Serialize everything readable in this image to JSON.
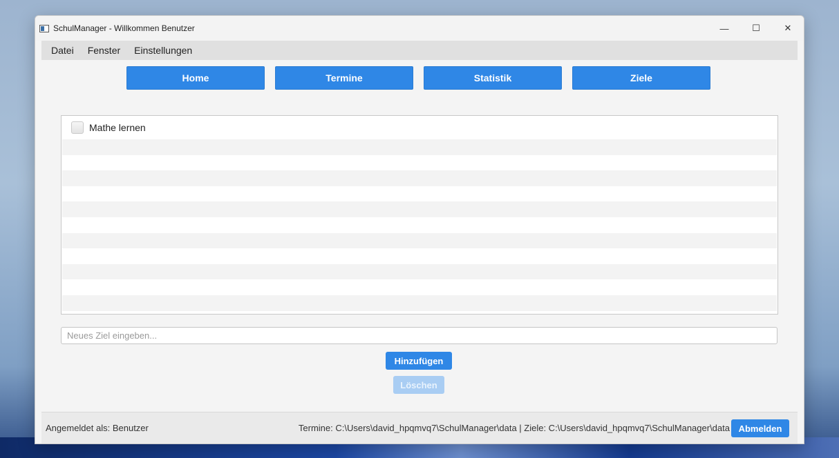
{
  "window": {
    "title": "SchulManager - Willkommen Benutzer",
    "controls": {
      "minimize": "—",
      "maximize": "☐",
      "close": "✕"
    }
  },
  "menu": {
    "items": [
      "Datei",
      "Fenster",
      "Einstellungen"
    ]
  },
  "nav": {
    "buttons": [
      "Home",
      "Termine",
      "Statistik",
      "Ziele"
    ]
  },
  "goals": {
    "items": [
      {
        "label": "Mathe lernen",
        "checked": false
      }
    ]
  },
  "form": {
    "placeholder": "Neues Ziel eingeben...",
    "value": "",
    "add_label": "Hinzufügen",
    "delete_label": "Löschen"
  },
  "status": {
    "user_text": "Angemeldet als: Benutzer",
    "paths_text": "Termine: C:\\Users\\david_hpqmvq7\\SchulManager\\data | Ziele: C:\\Users\\david_hpqmvq7\\SchulManager\\data",
    "logout_label": "Abmelden"
  },
  "colors": {
    "accent": "#2f87e6",
    "accent_disabled": "#a9cdf3",
    "menubar": "#e0e0e0",
    "window_bg": "#f4f4f4"
  },
  "icons": {
    "app": "app-window-icon",
    "minimize": "minimize-icon",
    "maximize": "maximize-icon",
    "close": "close-icon"
  }
}
